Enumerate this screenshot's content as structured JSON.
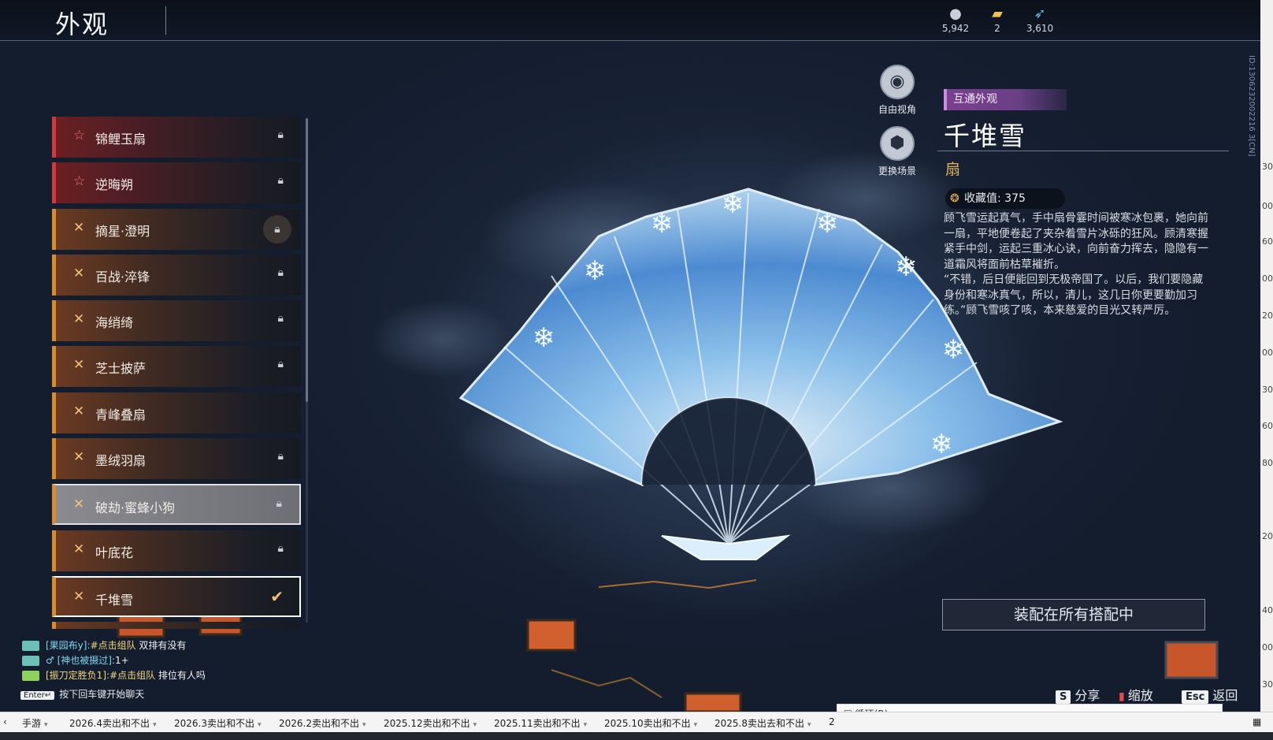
{
  "header": {
    "title": "外观",
    "currencies": [
      {
        "icon": "coin-stack-icon",
        "value": "5,942"
      },
      {
        "icon": "ticket-icon",
        "value": "2"
      },
      {
        "icon": "feather-icon",
        "value": "3,610"
      }
    ]
  },
  "list": {
    "items": [
      {
        "label": "锦鲤玉扇",
        "rarity": "red",
        "state": "locked"
      },
      {
        "label": "逆晦朔",
        "rarity": "red",
        "state": "locked"
      },
      {
        "label": "摘星·澄明",
        "rarity": "orange",
        "state": "locked-badge"
      },
      {
        "label": "百战·淬锋",
        "rarity": "orange",
        "state": "locked"
      },
      {
        "label": "海绡绮",
        "rarity": "orange",
        "state": "locked"
      },
      {
        "label": "芝士披萨",
        "rarity": "orange",
        "state": "locked"
      },
      {
        "label": "青峰叠扇",
        "rarity": "orange",
        "state": "none"
      },
      {
        "label": "墨绒羽扇",
        "rarity": "orange",
        "state": "locked"
      },
      {
        "label": "破劫·蜜蜂小狗",
        "rarity": "orange",
        "state": "hover-locked"
      },
      {
        "label": "叶底花",
        "rarity": "orange",
        "state": "locked"
      },
      {
        "label": "千堆雪",
        "rarity": "orange",
        "state": "selected"
      }
    ]
  },
  "camera": {
    "free_view": "自由视角",
    "change_scene": "更换场景"
  },
  "detail": {
    "tag": "互通外观",
    "name": "千堆雪",
    "type": "扇",
    "collect_label": "收藏值: 375",
    "description": "顾飞雪运起真气，手中扇骨霎时间被寒冰包裹，她向前一扇，平地便卷起了夹杂着雪片冰砾的狂风。顾清寒握紧手中剑，运起三重冰心诀，向前奋力挥去，隐隐有一道霜风将面前枯草摧折。\n“不错，后日便能回到无极帝国了。以后，我们要隐藏身份和寒冰真气，所以，清儿，这几日你更要勤加习练。”顾飞雪咳了咳，本来慈爱的目光又转严厉。",
    "equip_all": "装配在所有搭配中"
  },
  "footer": {
    "share_key": "S",
    "share": "分享",
    "zoom": "缩放",
    "back_key": "Esc",
    "back": "返回"
  },
  "chat": {
    "lines": [
      {
        "who": "[果园布y]:",
        "tag": "#点击组队",
        "text": " 双排有没有"
      },
      {
        "who": "♂ [神也被摄过]:",
        "tag": "",
        "text": "1+"
      },
      {
        "who": "[振刀定胜负1]:",
        "tag": "#点击组队",
        "text": " 排位有人吗"
      }
    ],
    "hint_key": "Enter↵",
    "hint": "按下回车键开始聊天"
  },
  "build_id": "ID:1306232002216 3[CN]",
  "edge_numbers": [
    "30",
    "00",
    "60",
    "00",
    "20",
    "00",
    "30",
    "60",
    "80",
    "20",
    "40",
    "00",
    "30"
  ],
  "taskbar": {
    "tabs": [
      "手游",
      "2026.4卖出和不出",
      "2026.3卖出和不出",
      "2026.2卖出和不出",
      "2025.12卖出和不出",
      "2025.11卖出和不出",
      "2025.10卖出和不出",
      "2025.8卖出去和不出",
      "2"
    ],
    "loop_checkbox": "循环(R)"
  }
}
